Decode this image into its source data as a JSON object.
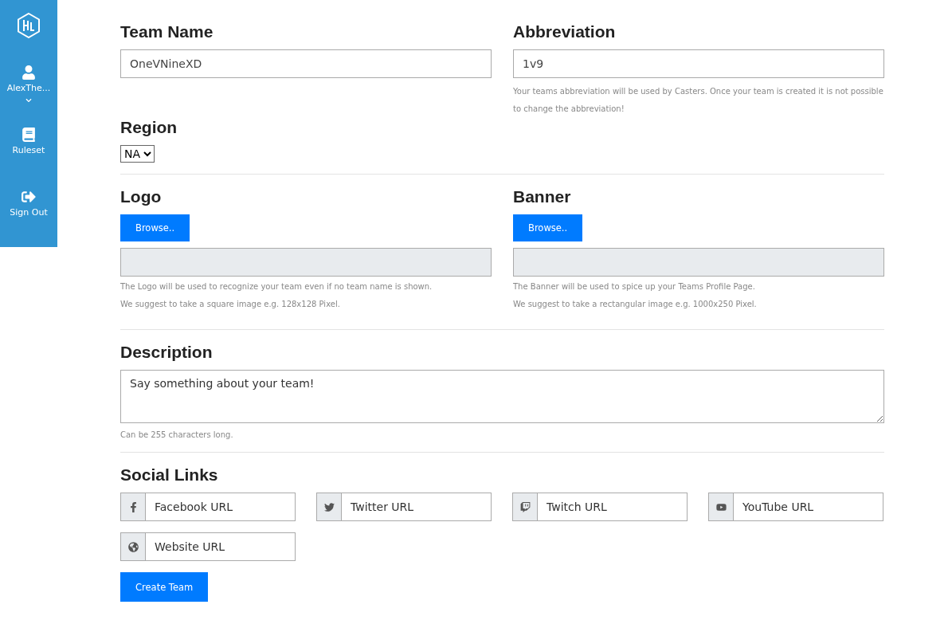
{
  "sidebar": {
    "items": [
      {
        "kind": "user",
        "label": "AlexThe...",
        "caret": true
      },
      {
        "kind": "ruleset",
        "label": "Ruleset",
        "caret": false
      },
      {
        "kind": "signout",
        "label": "Sign Out",
        "caret": false
      }
    ]
  },
  "team_name": {
    "label": "Team Name",
    "value": "OneVNineXD"
  },
  "abbreviation": {
    "label": "Abbreviation",
    "value": "1v9",
    "hint": "Your teams abbreviation will be used by Casters. Once your team is created it is not possible to change the abbreviation!"
  },
  "region": {
    "label": "Region",
    "value": "NA"
  },
  "uploads": [
    {
      "label": "Logo",
      "button": "Browse..",
      "hints": [
        "The Logo will be used to recognize your team even if no team name is shown.",
        "We suggest to take a square image e.g. 128x128 Pixel."
      ]
    },
    {
      "label": "Banner",
      "button": "Browse..",
      "hints": [
        "The Banner will be used to spice up your Teams Profile Page.",
        "We suggest to take a rectangular image e.g. 1000x250 Pixel."
      ]
    }
  ],
  "description": {
    "label": "Description",
    "placeholder": "Say something about your team!",
    "hint": "Can be 255 characters long."
  },
  "social_links": {
    "label": "Social Links",
    "items": [
      {
        "kind": "facebook",
        "placeholder": "Facebook URL"
      },
      {
        "kind": "twitter",
        "placeholder": "Twitter URL"
      },
      {
        "kind": "twitch",
        "placeholder": "Twitch URL"
      },
      {
        "kind": "youtube",
        "placeholder": "YouTube URL"
      },
      {
        "kind": "website",
        "placeholder": "Website URL"
      }
    ]
  },
  "submit": "Create Team"
}
